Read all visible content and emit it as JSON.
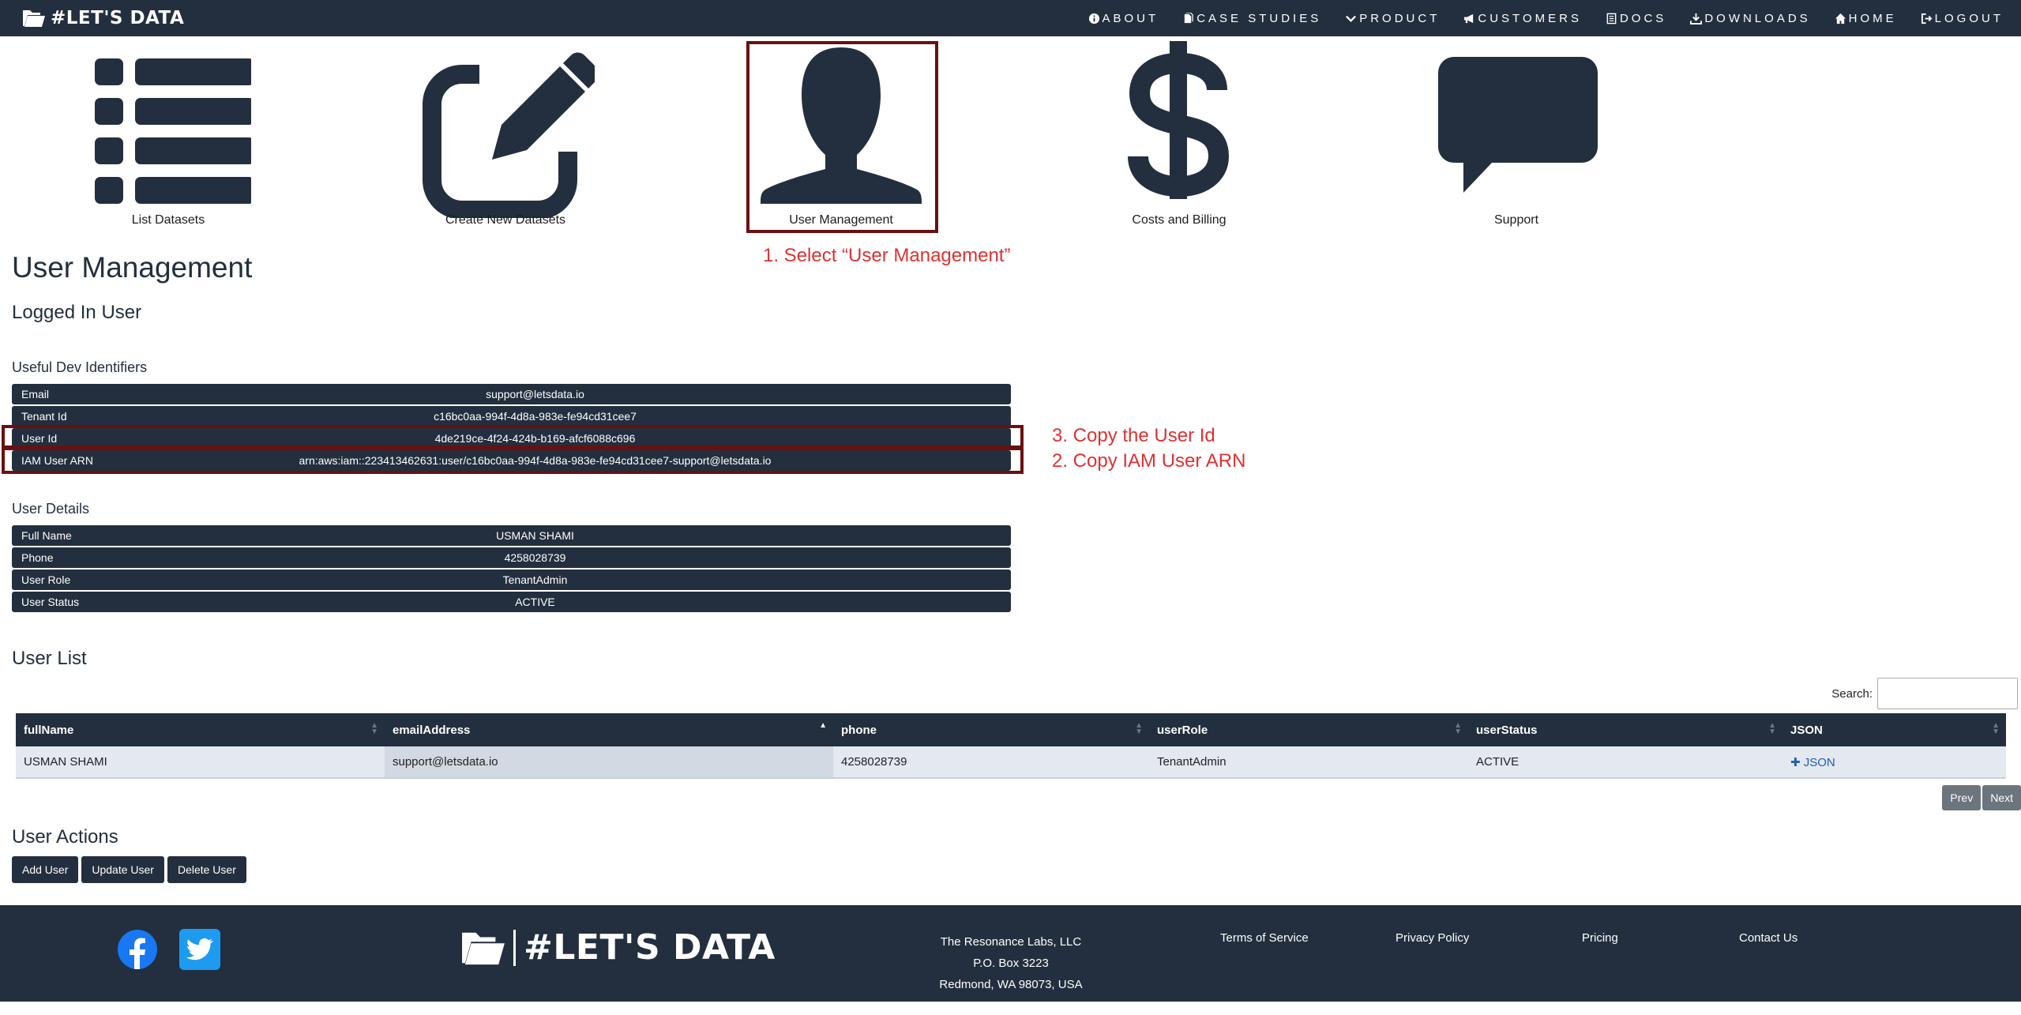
{
  "nav": {
    "brand": "#LET'S DATA",
    "links": [
      {
        "label": "ABOUT",
        "icon": "info-icon"
      },
      {
        "label": "CASE STUDIES",
        "icon": "files-icon"
      },
      {
        "label": "PRODUCT",
        "icon": "chevron-down-icon"
      },
      {
        "label": "CUSTOMERS",
        "icon": "megaphone-icon"
      },
      {
        "label": "DOCS",
        "icon": "document-icon"
      },
      {
        "label": "DOWNLOADS",
        "icon": "download-icon"
      },
      {
        "label": "HOME",
        "icon": "home-icon"
      },
      {
        "label": "LOGOUT",
        "icon": "logout-icon"
      }
    ]
  },
  "tiles": [
    {
      "label": "List Datasets",
      "icon": "list-icon"
    },
    {
      "label": "Create New Datasets",
      "icon": "edit-icon"
    },
    {
      "label": "User Management",
      "icon": "user-icon"
    },
    {
      "label": "Costs and Billing",
      "icon": "dollar-icon"
    },
    {
      "label": "Support",
      "icon": "chat-bubble-icon"
    }
  ],
  "annotations": {
    "step1": "1. Select “User Management”",
    "step3": "3. Copy the User Id",
    "step2": "2. Copy IAM User ARN"
  },
  "page": {
    "title": "User Management",
    "logged_in": "Logged In User",
    "dev_ids_title": "Useful Dev Identifiers",
    "user_details_title": "User Details",
    "user_list_title": "User List",
    "user_actions_title": "User Actions"
  },
  "dev_ids": [
    {
      "key": "Email",
      "value": "support@letsdata.io"
    },
    {
      "key": "Tenant Id",
      "value": "c16bc0aa-994f-4d8a-983e-fe94cd31cee7"
    },
    {
      "key": "User Id",
      "value": "4de219ce-4f24-424b-b169-afcf6088c696"
    },
    {
      "key": "IAM User ARN",
      "value": "arn:aws:iam::223413462631:user/c16bc0aa-994f-4d8a-983e-fe94cd31cee7-support@letsdata.io"
    }
  ],
  "user_details": [
    {
      "key": "Full Name",
      "value": "USMAN SHAMI"
    },
    {
      "key": "Phone",
      "value": "4258028739"
    },
    {
      "key": "User Role",
      "value": "TenantAdmin"
    },
    {
      "key": "User Status",
      "value": "ACTIVE"
    }
  ],
  "user_list": {
    "search_label": "Search:",
    "search_value": "",
    "columns": [
      "fullName",
      "emailAddress",
      "phone",
      "userRole",
      "userStatus",
      "JSON"
    ],
    "rows": [
      [
        "USMAN SHAMI",
        "support@letsdata.io",
        "4258028739",
        "TenantAdmin",
        "ACTIVE",
        "JSON"
      ]
    ],
    "prev": "Prev",
    "next": "Next"
  },
  "actions": {
    "add": "Add User",
    "update": "Update User",
    "delete": "Delete User"
  },
  "footer": {
    "brand": "#LET'S DATA",
    "company": "The Resonance Labs, LLC",
    "po_box": "P.O. Box 3223",
    "city": "Redmond, WA 98073, USA",
    "terms": "Terms of Service",
    "privacy": "Privacy Policy",
    "pricing": "Pricing",
    "contact": "Contact Us"
  },
  "colors": {
    "navy": "#232f3e",
    "annotation_red": "#e03131",
    "highlight_box": "#6b1010",
    "facebook": "#1877f2",
    "twitter": "#1d9bf0"
  }
}
